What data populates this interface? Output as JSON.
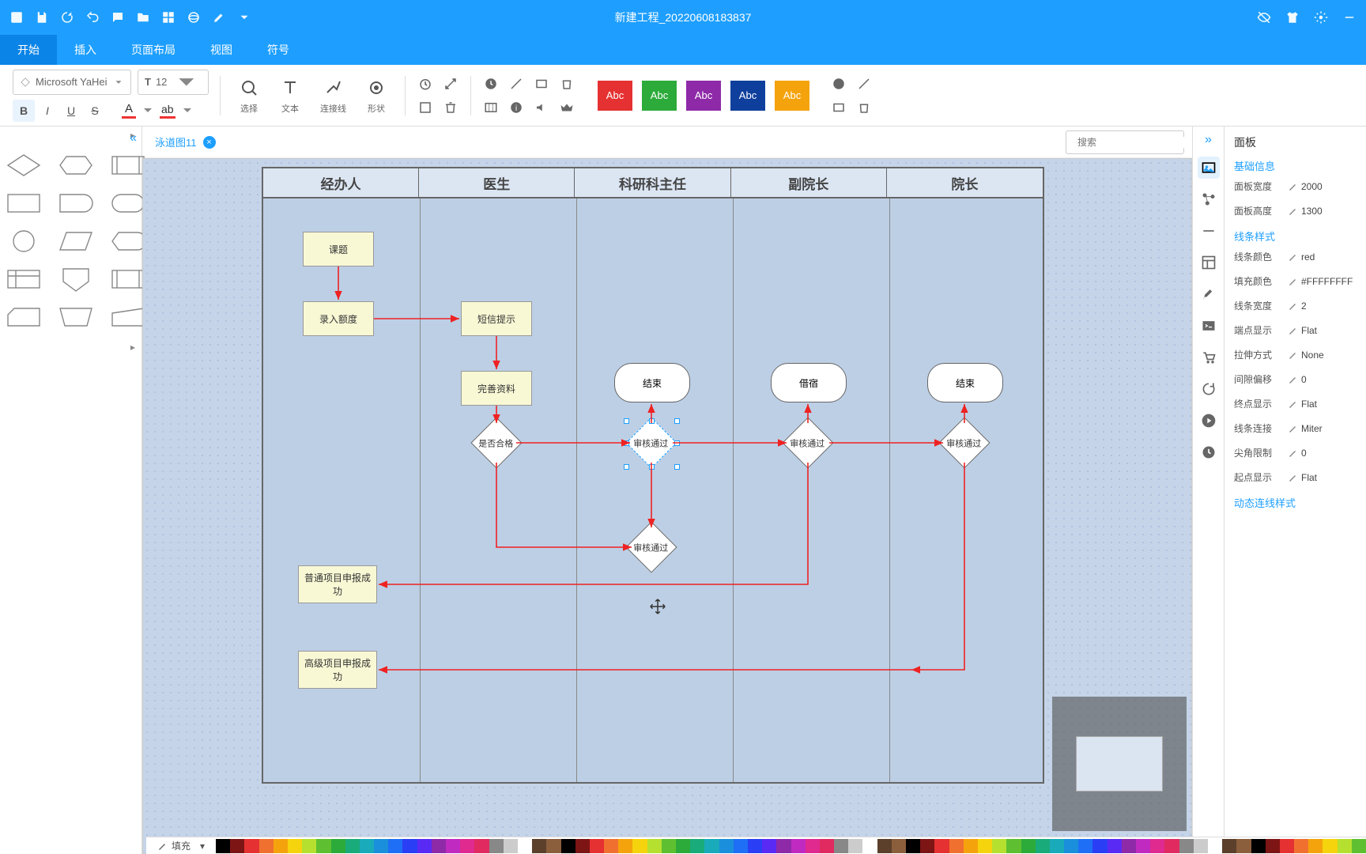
{
  "titlebar": {
    "title": "新建工程_20220608183837"
  },
  "menu": {
    "start": "开始",
    "insert": "插入",
    "layout": "页面布局",
    "view": "视图",
    "symbol": "符号"
  },
  "ribbon": {
    "font": "Microsoft YaHei",
    "size": "12",
    "bold": "B",
    "italic": "I",
    "underline": "U",
    "strike": "S",
    "textA": "A",
    "textAb": "ab",
    "select": "选择",
    "text": "文本",
    "connect": "连接线",
    "shape": "形状",
    "swatch": "Abc",
    "swatch_colors": [
      "#e53131",
      "#2cab3a",
      "#8e2aa8",
      "#0f3f9d",
      "#f5a30d"
    ]
  },
  "tab": {
    "name": "泳道图11"
  },
  "search": {
    "placeholder": "搜索"
  },
  "swimlane": {
    "lanes": [
      "经办人",
      "医生",
      "科研科主任",
      "副院长",
      "院长"
    ],
    "nodes": {
      "keti": "课题",
      "luru": "录入额度",
      "duanxin": "短信提示",
      "wanshan": "完善资料",
      "shifou": "是否合格",
      "sh1": "审核通过",
      "sh2": "审核通过",
      "sh3": "审核通过",
      "sh4": "审核通过",
      "jieshu1": "结束",
      "jiesu": "借宿",
      "jieshu2": "结束",
      "putong": "普通项目申报成功",
      "gaoji": "高级项目申报成功"
    }
  },
  "right": {
    "panel": "面板"
  },
  "props": {
    "section1": "基础信息",
    "width_l": "面板宽度",
    "width_v": "2000",
    "height_l": "面板高度",
    "height_v": "1300",
    "section2": "线条样式",
    "color_l": "线条颜色",
    "color_v": "red",
    "fill_l": "填充颜色",
    "fill_v": "#FFFFFFFF",
    "lw_l": "线条宽度",
    "lw_v": "2",
    "cap_l": "端点显示",
    "cap_v": "Flat",
    "stretch_l": "拉伸方式",
    "stretch_v": "None",
    "gap_l": "间隙偏移",
    "gap_v": "0",
    "end_l": "终点显示",
    "end_v": "Flat",
    "join_l": "线条连接",
    "join_v": "Miter",
    "miter_l": "尖角限制",
    "miter_v": "0",
    "startcap_l": "起点显示",
    "startcap_v": "Flat",
    "section3": "动态连线样式"
  },
  "colorbar": {
    "fill": "填充"
  },
  "palette": [
    "#000",
    "#7e1515",
    "#e53131",
    "#f07030",
    "#f5a30d",
    "#f5d30d",
    "#b5e030",
    "#5ec030",
    "#2cab3a",
    "#1aab7a",
    "#1aabbb",
    "#1a8fdb",
    "#1e6ff5",
    "#2a3ff5",
    "#5a2af5",
    "#8e2aa8",
    "#c02ac0",
    "#e02a90",
    "#e02a60",
    "#888",
    "#ccc",
    "#fff",
    "#5c402b",
    "#8b5e3c"
  ]
}
